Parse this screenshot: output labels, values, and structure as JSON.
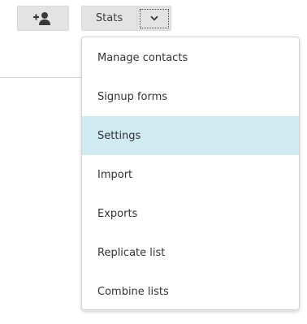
{
  "toolbar": {
    "add_contact_icon": "add-user-icon",
    "stats_label": "Stats",
    "dropdown_icon": "chevron-down-icon"
  },
  "menu": {
    "items": [
      {
        "label": "Manage contacts",
        "active": false
      },
      {
        "label": "Signup forms",
        "active": false
      },
      {
        "label": "Settings",
        "active": true
      },
      {
        "label": "Import",
        "active": false
      },
      {
        "label": "Exports",
        "active": false
      },
      {
        "label": "Replicate list",
        "active": false
      },
      {
        "label": "Combine lists",
        "active": false
      }
    ]
  },
  "colors": {
    "highlight": "#cfeaf0",
    "button_bg": "#e3e3e3",
    "text": "#333333"
  }
}
